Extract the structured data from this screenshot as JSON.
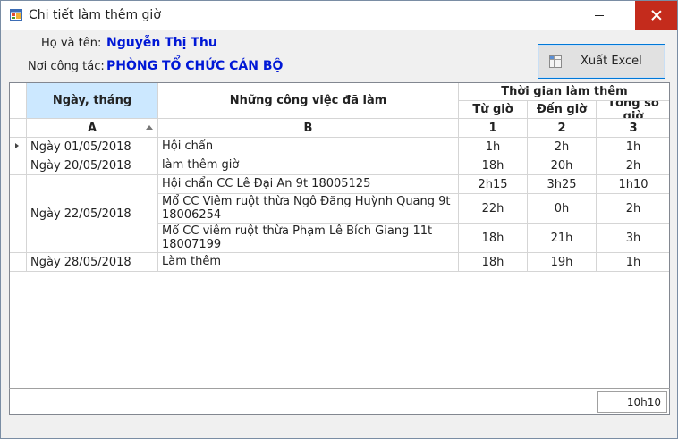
{
  "window": {
    "title": "Chi tiết làm thêm giờ"
  },
  "info": {
    "name_label": "Họ và tên:",
    "name_value": "Nguyễn Thị Thu",
    "dept_label": "Nơi công tác:",
    "dept_value": "PHÒNG TỔ CHỨC CÁN BỘ"
  },
  "toolbar": {
    "export_label": "Xuất Excel"
  },
  "grid": {
    "headers": {
      "date": "Ngày, tháng",
      "work": "Những công việc đã làm",
      "overtime_group": "Thời gian làm thêm",
      "from": "Từ giờ",
      "to": "Đến giờ",
      "total": "Tổng số giờ"
    },
    "sub_headers": {
      "date": "A",
      "work": "B",
      "from": "1",
      "to": "2",
      "total": "3"
    },
    "dates": [
      "Ngày 01/05/2018",
      "Ngày 20/05/2018",
      "Ngày 22/05/2018",
      "Ngày 28/05/2018"
    ],
    "rows": [
      {
        "work": "Hội chẩn",
        "from": "1h",
        "to": "2h",
        "total": "1h"
      },
      {
        "work": "làm thêm giờ",
        "from": "18h",
        "to": "20h",
        "total": "2h"
      },
      {
        "work": "Hội chẩn CC Lê Đại An 9t 18005125",
        "from": "2h15",
        "to": "3h25",
        "total": "1h10"
      },
      {
        "work": "Mổ CC Viêm ruột thừa Ngô Đăng Huỳnh Quang 9t 18006254",
        "from": "22h",
        "to": "0h",
        "total": "2h"
      },
      {
        "work": "Mổ CC viêm ruột thừa Phạm Lê Bích Giang 11t 18007199",
        "from": "18h",
        "to": "21h",
        "total": "3h"
      },
      {
        "work": "Làm thêm",
        "from": "18h",
        "to": "19h",
        "total": "1h"
      }
    ],
    "grand_total": "10h10"
  }
}
